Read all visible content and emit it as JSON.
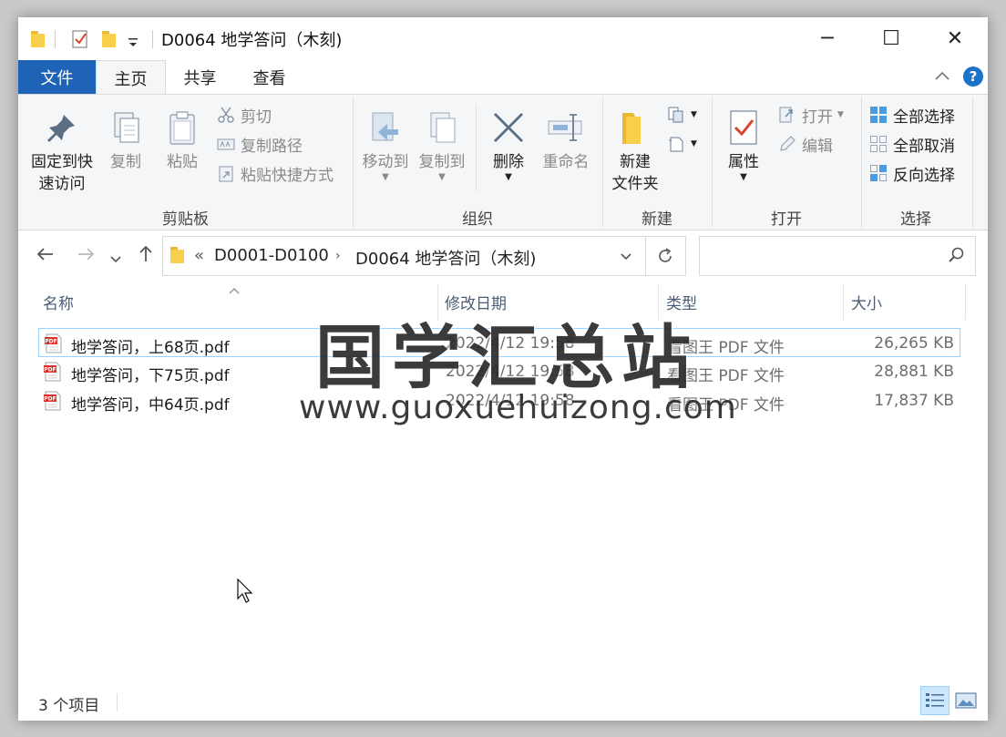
{
  "window": {
    "title": "D0064 地学答问（木刻)",
    "controls": {
      "minimize": "─",
      "maximize": "☐",
      "close": "✕"
    }
  },
  "ribbon": {
    "tabs": [
      "文件",
      "主页",
      "共享",
      "查看"
    ],
    "active_tab": "主页",
    "groups": {
      "clipboard": {
        "label": "剪贴板",
        "pin": "固定到快",
        "pin2": "速访问",
        "copy": "复制",
        "paste": "粘贴",
        "cut": "剪切",
        "copy_path": "复制路径",
        "paste_shortcut": "粘贴快捷方式"
      },
      "organize": {
        "label": "组织",
        "move_to": "移动到",
        "copy_to": "复制到",
        "delete": "删除",
        "rename": "重命名"
      },
      "new": {
        "label": "新建",
        "new_folder": "新建",
        "new_folder2": "文件夹"
      },
      "open": {
        "label": "打开",
        "properties": "属性",
        "open": "打开",
        "edit": "编辑"
      },
      "select": {
        "label": "选择",
        "select_all": "全部选择",
        "select_none": "全部取消",
        "invert": "反向选择"
      }
    }
  },
  "address": {
    "overflow": "«",
    "crumbs": [
      "D0001-D0100",
      "D0064 地学答问（木刻)"
    ],
    "search_placeholder": ""
  },
  "columns": {
    "name": "名称",
    "date": "修改日期",
    "type": "类型",
    "size": "大小"
  },
  "files": [
    {
      "name": "地学答问，上68页.pdf",
      "date": "2022/4/12 19:58",
      "type": "看图王 PDF 文件",
      "size": "26,265 KB"
    },
    {
      "name": "地学答问，下75页.pdf",
      "date": "2022/4/12 19:58",
      "type": "看图王 PDF 文件",
      "size": "28,881 KB"
    },
    {
      "name": "地学答问，中64页.pdf",
      "date": "2022/4/12 19:58",
      "type": "看图王 PDF 文件",
      "size": "17,837 KB"
    }
  ],
  "status": {
    "count": "3 个项目"
  },
  "watermark": {
    "title": "国学汇总站",
    "url": "www.guoxuehuizong.com"
  },
  "colors": {
    "file_tab": "#1e63b5",
    "accent_blue": "#1a73c8",
    "selection_border": "#99d1ff"
  }
}
